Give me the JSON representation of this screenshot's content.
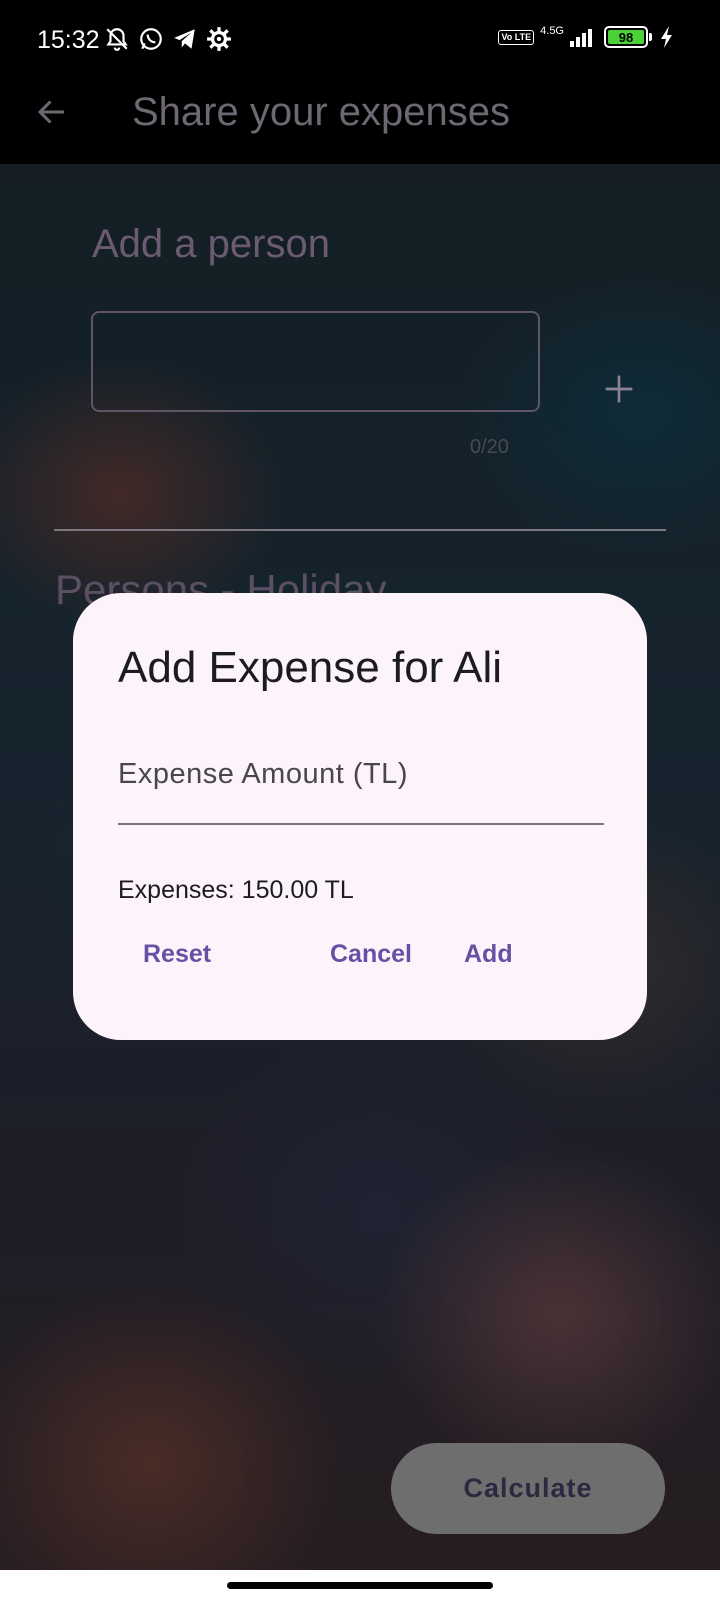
{
  "status_bar": {
    "time": "15:32",
    "network": "4.5G",
    "volte": "Vo LTE",
    "battery": "98",
    "battery_color": "#4cd137"
  },
  "app_bar": {
    "title": "Share your expenses",
    "back_icon": "arrow-back-icon"
  },
  "main": {
    "add_person_title": "Add a person",
    "name_input_value": "",
    "char_count": "0/20",
    "add_icon": "plus-icon",
    "persons_heading": "Persons - Holiday"
  },
  "dialog": {
    "title": "Add Expense for Ali",
    "amount_label": "Expense Amount (TL)",
    "amount_value": "",
    "expenses_text": "Expenses: 150.00 TL",
    "reset_label": "Reset",
    "cancel_label": "Cancel",
    "add_label": "Add",
    "accent": "#6750a4",
    "surface": "#fdf4fb"
  },
  "footer": {
    "calculate_label": "Calculate"
  }
}
